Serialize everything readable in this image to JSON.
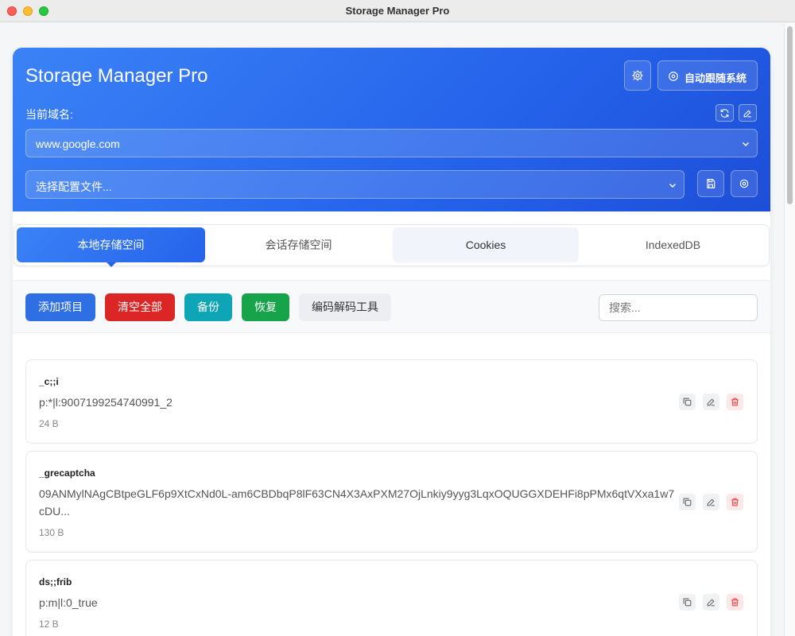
{
  "window": {
    "title": "Storage Manager Pro"
  },
  "header": {
    "title": "Storage Manager Pro",
    "follow_label": "自动跟随系统",
    "domain_label": "当前域名:",
    "domain_value": "www.google.com",
    "profile_placeholder": "选择配置文件..."
  },
  "tabs": [
    {
      "label": "本地存储空间",
      "active": true
    },
    {
      "label": "会话存储空间",
      "active": false
    },
    {
      "label": "Cookies",
      "active": false
    },
    {
      "label": "IndexedDB",
      "active": false
    }
  ],
  "toolbar": {
    "add_label": "添加项目",
    "clear_label": "清空全部",
    "backup_label": "备份",
    "restore_label": "恢复",
    "codec_label": "编码解码工具",
    "search_placeholder": "搜索..."
  },
  "items": [
    {
      "key": "_c;;i",
      "value": "p:*|l:9007199254740991_2",
      "size": "24 B"
    },
    {
      "key": "_grecaptcha",
      "value": "09ANMylNAgCBtpeGLF6p9XtCxNd0L-am6CBDbqP8lF63CN4X3AxPXM27OjLnkiy9yyg3LqxOQUGGXDEHFi8pPMx6qtVXxa1w7cDU...",
      "size": "130 B"
    },
    {
      "key": "ds;;frib",
      "value": "p:m|l:0_true",
      "size": "12 B"
    }
  ],
  "colors": {
    "header_gradient_start": "#3b82f6",
    "header_gradient_end": "#1d4ed8",
    "add": "#2f6fe4",
    "clear": "#dc2626",
    "backup": "#0ea5b7",
    "restore": "#16a34a"
  },
  "icons": [
    "gear-icon",
    "target-icon",
    "refresh-icon",
    "edit-icon",
    "chevron-down-icon",
    "save-icon",
    "copy-icon",
    "trash-icon"
  ]
}
